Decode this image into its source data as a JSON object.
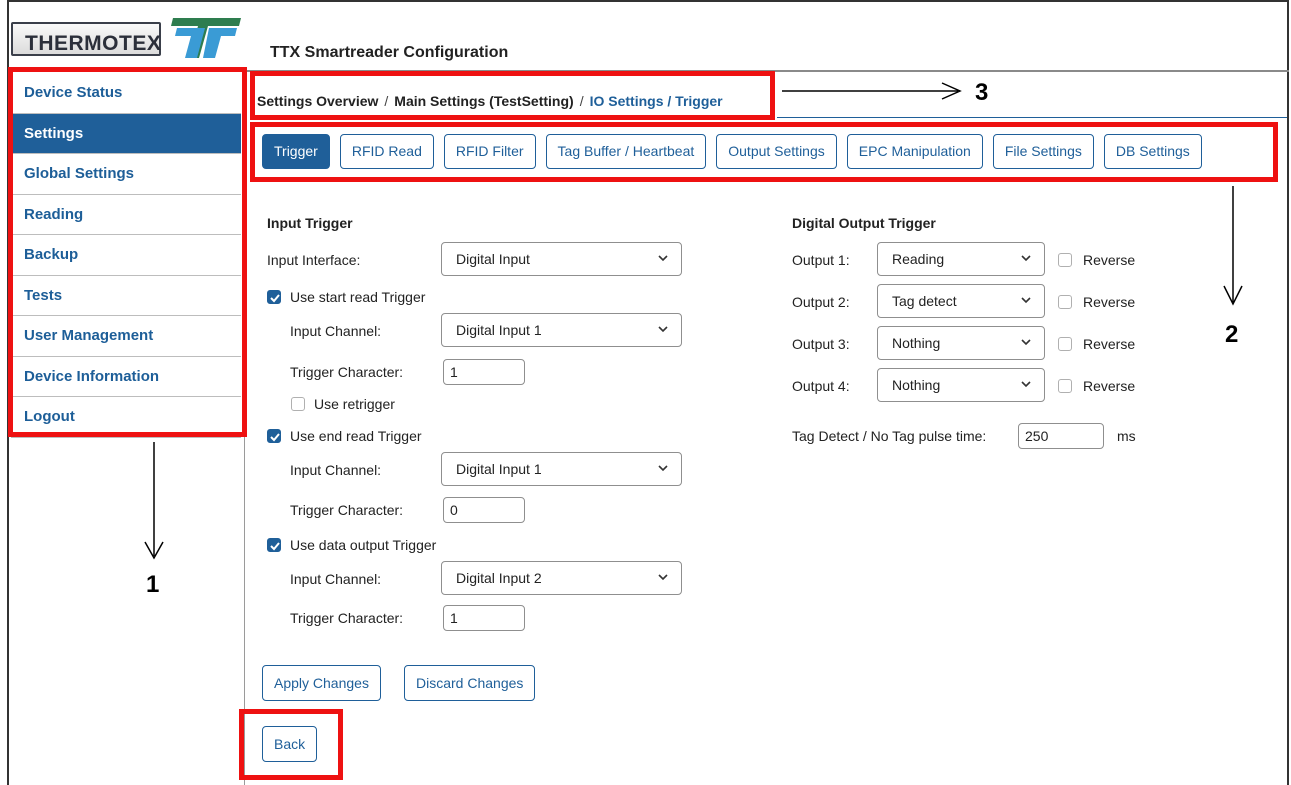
{
  "logo": {
    "text": "THERMOTEX"
  },
  "app_title": "TTX Smartreader Configuration",
  "sidebar": {
    "items": [
      {
        "label": "Device Status",
        "active": false
      },
      {
        "label": "Settings",
        "active": true
      },
      {
        "label": "Global Settings",
        "active": false
      },
      {
        "label": "Reading",
        "active": false
      },
      {
        "label": "Backup",
        "active": false
      },
      {
        "label": "Tests",
        "active": false
      },
      {
        "label": "User Management",
        "active": false
      },
      {
        "label": "Device Information",
        "active": false
      },
      {
        "label": "Logout",
        "active": false
      }
    ]
  },
  "breadcrumb": {
    "items": [
      "Settings Overview",
      "Main Settings (TestSetting)",
      "IO Settings / Trigger"
    ],
    "separator": "/"
  },
  "tabs": [
    {
      "label": "Trigger",
      "active": true
    },
    {
      "label": "RFID Read",
      "active": false
    },
    {
      "label": "RFID Filter",
      "active": false
    },
    {
      "label": "Tag Buffer / Heartbeat",
      "active": false
    },
    {
      "label": "Output Settings",
      "active": false
    },
    {
      "label": "EPC Manipulation",
      "active": false
    },
    {
      "label": "File Settings",
      "active": false
    },
    {
      "label": "DB Settings",
      "active": false
    }
  ],
  "input_trigger": {
    "title": "Input Trigger",
    "interface_label": "Input Interface:",
    "interface_value": "Digital Input",
    "start": {
      "label": "Use start read Trigger",
      "checked": true,
      "channel_label": "Input Channel:",
      "channel_value": "Digital Input 1",
      "char_label": "Trigger Character:",
      "char_value": "1",
      "retrigger_label": "Use retrigger",
      "retrigger_checked": false
    },
    "end": {
      "label": "Use end read Trigger",
      "checked": true,
      "channel_label": "Input Channel:",
      "channel_value": "Digital Input 1",
      "char_label": "Trigger Character:",
      "char_value": "0"
    },
    "data_output": {
      "label": "Use data output Trigger",
      "checked": true,
      "channel_label": "Input Channel:",
      "channel_value": "Digital Input 2",
      "char_label": "Trigger Character:",
      "char_value": "1"
    }
  },
  "digital_output": {
    "title": "Digital Output Trigger",
    "outputs": [
      {
        "label": "Output 1:",
        "value": "Reading",
        "reverse_label": "Reverse",
        "reverse": false
      },
      {
        "label": "Output 2:",
        "value": "Tag detect",
        "reverse_label": "Reverse",
        "reverse": false
      },
      {
        "label": "Output 3:",
        "value": "Nothing",
        "reverse_label": "Reverse",
        "reverse": false
      },
      {
        "label": "Output 4:",
        "value": "Nothing",
        "reverse_label": "Reverse",
        "reverse": false
      }
    ],
    "pulse_label": "Tag Detect / No Tag pulse time:",
    "pulse_value": "250",
    "pulse_unit": "ms"
  },
  "buttons": {
    "apply": "Apply Changes",
    "discard": "Discard Changes",
    "back": "Back"
  },
  "annotations": {
    "one": "1",
    "two": "2",
    "three": "3"
  },
  "colors": {
    "accent": "#1f5f99",
    "annotation": "#ee1111"
  }
}
